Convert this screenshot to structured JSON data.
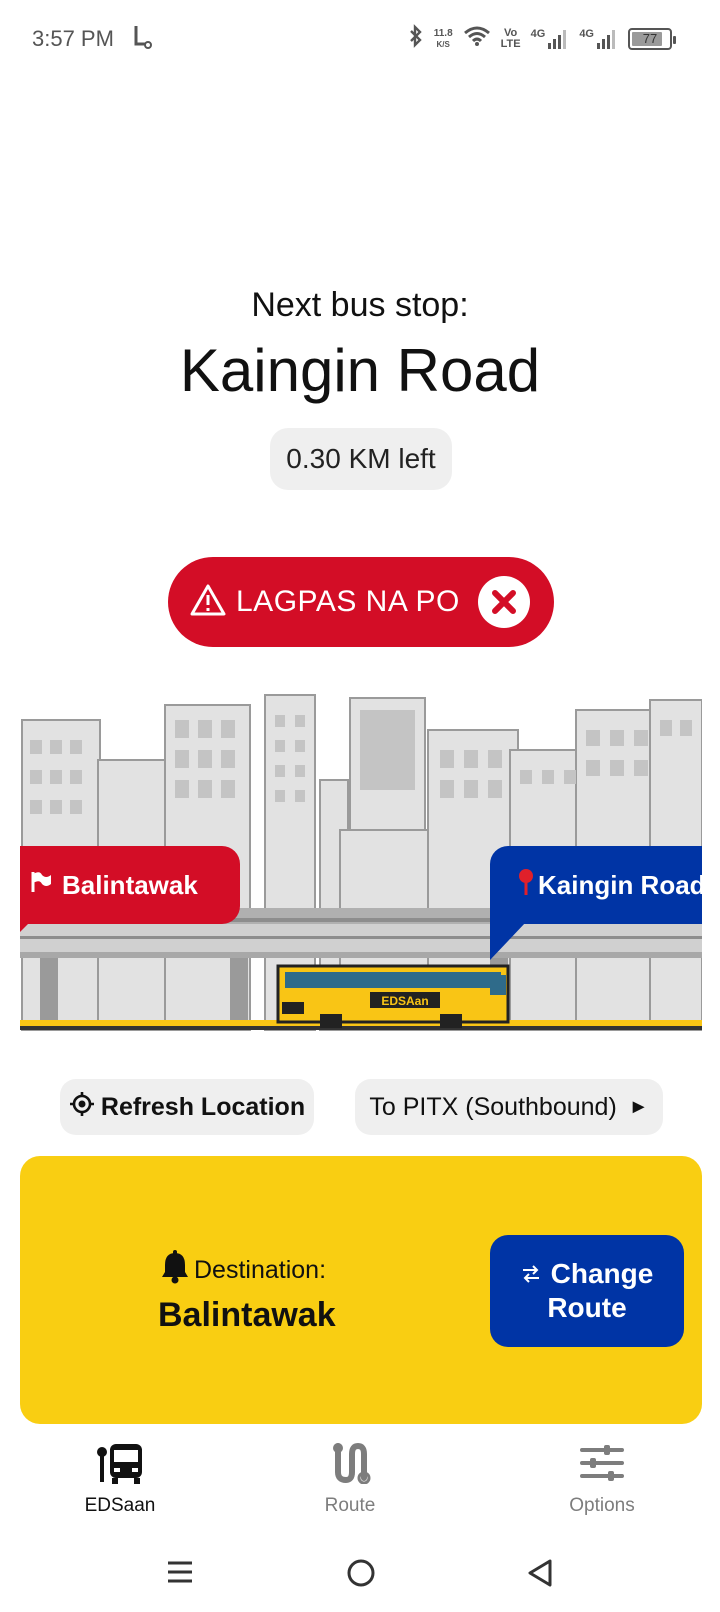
{
  "status_bar": {
    "time": "3:57 PM",
    "net_speed_value": "11.8",
    "net_speed_unit": "K/S",
    "volte_top": "Vo",
    "volte_bottom": "LTE",
    "signal1_label": "4G",
    "signal2_label": "4G",
    "battery": "77"
  },
  "next_stop": {
    "label": "Next bus stop:",
    "name": "Kaingin Road",
    "distance": "0.30 KM left"
  },
  "alert": {
    "label": "LAGPAS NA PO",
    "color": "#d30d26"
  },
  "scene": {
    "origin_tag": "Balintawak",
    "destination_tag": "Kaingin Road",
    "bus_label": "EDSAan",
    "bus_color": "#f9c515"
  },
  "actions": {
    "refresh_label": "Refresh Location",
    "direction_label": "To PITX (Southbound)",
    "direction_arrow": "►"
  },
  "destination_card": {
    "label": "Destination:",
    "value": "Balintawak",
    "change_button_line1": "Change",
    "change_button_line2": "Route",
    "color": "#f9ce12",
    "button_color": "#0034a5"
  },
  "bottom_nav": {
    "items": [
      {
        "label": "EDSaan",
        "icon": "bus-stop-icon",
        "active": true
      },
      {
        "label": "Route",
        "icon": "route-icon",
        "active": false
      },
      {
        "label": "Options",
        "icon": "sliders-icon",
        "active": false
      }
    ]
  }
}
